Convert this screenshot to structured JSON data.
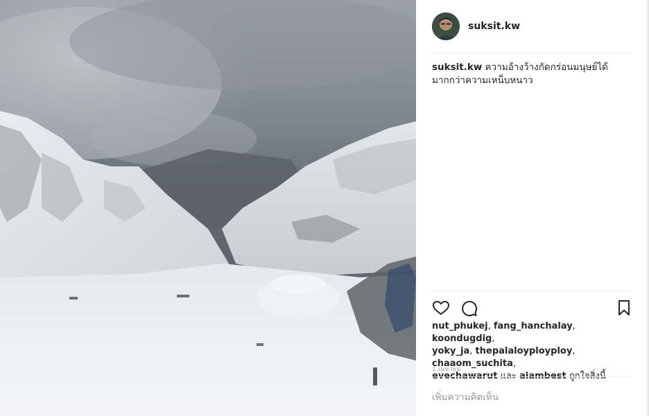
{
  "post": {
    "username": "suksit.kw",
    "caption_user": "suksit.kw",
    "caption_text": "ความอ้างว้างกัดกร่อนมนุษย์ได้มากกว่าความเหน็บหนาว",
    "timestamp": "1 เมษายน"
  },
  "likes": {
    "users": [
      {
        "name": "nut_phukej",
        "sep": ", "
      },
      {
        "name": "fang_hanchalay",
        "sep": ", "
      },
      {
        "name": "koondugdig",
        "sep": ", "
      },
      {
        "name": "yoky_ja",
        "sep": ", "
      },
      {
        "name": "thepalaloyployploy",
        "sep": ", "
      },
      {
        "name": "chaaom_suchita",
        "sep": ", "
      },
      {
        "name": "evechawarut",
        "sep": " และ "
      },
      {
        "name": "aiambest",
        "sep": ""
      }
    ],
    "suffix": " ถูกใจสิ่งนี้"
  },
  "comment": {
    "placeholder": "เพิ่มความคิดเห็น"
  },
  "icons": {
    "like": "heart-icon",
    "comment": "comment-bubble-icon",
    "save": "bookmark-icon"
  }
}
